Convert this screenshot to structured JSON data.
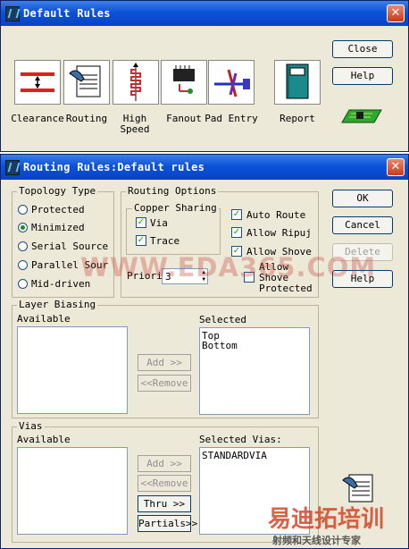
{
  "default_rules": {
    "title": "Default Rules",
    "close_label": "Close",
    "help_label": "Help",
    "tools": [
      {
        "label": "Clearance",
        "icon": "clearance-icon"
      },
      {
        "label": "Routing",
        "icon": "routing-icon"
      },
      {
        "label": "High Speed",
        "icon": "high-speed-icon"
      },
      {
        "label": "Fanout",
        "icon": "fanout-icon"
      },
      {
        "label": "Pad Entry",
        "icon": "pad-entry-icon"
      },
      {
        "label": "Report",
        "icon": "report-icon"
      }
    ]
  },
  "routing_rules": {
    "title": "Routing Rules:Default rules",
    "topology": {
      "label": "Topology Type",
      "options": [
        "Protected",
        "Minimized",
        "Serial Source",
        "Parallel Sour",
        "Mid-driven"
      ],
      "selected": "Minimized"
    },
    "routing_options": {
      "label": "Routing Options",
      "copper_sharing": {
        "label": "Copper Sharing",
        "via": {
          "label": "Via",
          "checked": true
        },
        "trace": {
          "label": "Trace",
          "checked": true
        }
      },
      "auto_route": {
        "label": "Auto Route",
        "checked": true
      },
      "allow_ripup": {
        "label": "Allow Ripuj",
        "checked": true
      },
      "allow_shove": {
        "label": "Allow Shove",
        "checked": true
      },
      "allow_shove_protected": {
        "label": "Allow Shove Protected",
        "checked": false
      },
      "priority_label": "Priori",
      "priority_value": "3"
    },
    "buttons": {
      "ok": "OK",
      "cancel": "Cancel",
      "delete": "Delete",
      "help": "Help"
    },
    "layer_biasing": {
      "label": "Layer Biasing",
      "available_label": "Available",
      "selected_label": "Selected",
      "available": [],
      "selected": [
        "Top",
        "Bottom"
      ],
      "add_label": "Add >>",
      "remove_label": "<<Remove"
    },
    "vias": {
      "label": "Vias",
      "available_label": "Available",
      "selected_label": "Selected Vias:",
      "available": [],
      "selected": [
        "STANDARDVIA"
      ],
      "add_label": "Add >>",
      "remove_label": "<<Remove",
      "thru_label": "Thru >>",
      "partials_label": "Partials>>"
    }
  },
  "watermark": {
    "site": "WWW.EDA365.COM",
    "brand": "易迪拓培训",
    "tagline": "射频和天线设计专家"
  }
}
